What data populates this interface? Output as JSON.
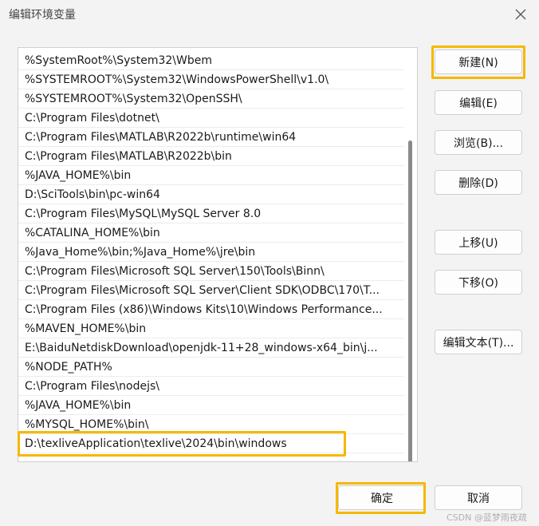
{
  "window": {
    "title": "编辑环境变量",
    "close_icon": "close-icon"
  },
  "path_list": {
    "items": [
      "%SystemRoot%\\System32\\Wbem",
      "%SYSTEMROOT%\\System32\\WindowsPowerShell\\v1.0\\",
      "%SYSTEMROOT%\\System32\\OpenSSH\\",
      "C:\\Program Files\\dotnet\\",
      "C:\\Program Files\\MATLAB\\R2022b\\runtime\\win64",
      "C:\\Program Files\\MATLAB\\R2022b\\bin",
      "%JAVA_HOME%\\bin",
      "D:\\SciTools\\bin\\pc-win64",
      "C:\\Program Files\\MySQL\\MySQL Server 8.0",
      "%CATALINA_HOME%\\bin",
      "%Java_Home%\\bin;%Java_Home%\\jre\\bin",
      "C:\\Program Files\\Microsoft SQL Server\\150\\Tools\\Binn\\",
      "C:\\Program Files\\Microsoft SQL Server\\Client SDK\\ODBC\\170\\T...",
      "C:\\Program Files (x86)\\Windows Kits\\10\\Windows Performance...",
      "%MAVEN_HOME%\\bin",
      "E:\\BaiduNetdiskDownload\\openjdk-11+28_windows-x64_bin\\j...",
      "%NODE_PATH%",
      "C:\\Program Files\\nodejs\\",
      "%JAVA_HOME%\\bin",
      "%MYSQL_HOME%\\bin\\",
      "D:\\texliveApplication\\texlive\\2024\\bin\\windows"
    ],
    "highlighted_item": "D:\\texliveApplication\\texlive\\2024\\bin\\windows"
  },
  "buttons": {
    "new": "新建(N)",
    "edit": "编辑(E)",
    "browse": "浏览(B)...",
    "delete": "删除(D)",
    "move_up": "上移(U)",
    "move_down": "下移(O)",
    "edit_text": "编辑文本(T)...",
    "ok": "确定",
    "cancel": "取消"
  },
  "colors": {
    "highlight": "#f5b800",
    "background": "#f3f3f3"
  },
  "watermark": "CSDN @蓝梦雨夜疏"
}
